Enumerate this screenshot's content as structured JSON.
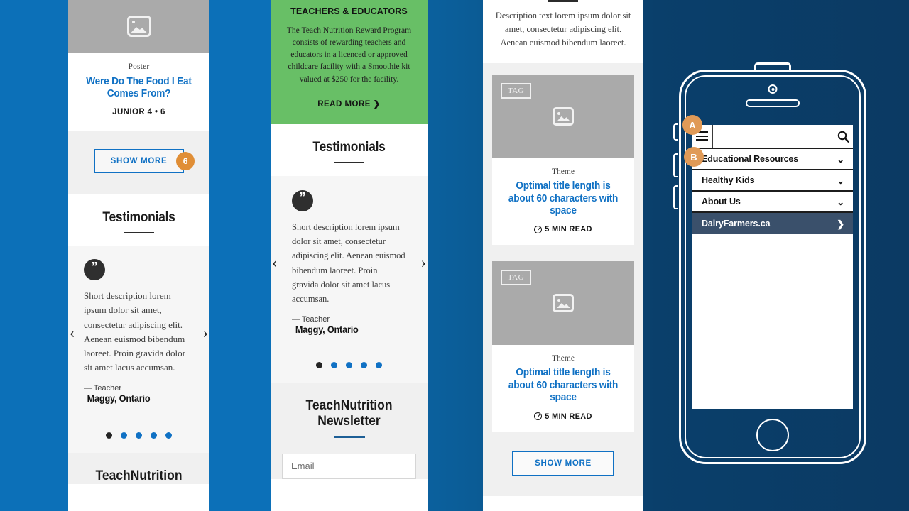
{
  "colors": {
    "bg_left": "#0c70b8",
    "bg_right": "#0b3a63",
    "accent_blue": "#1071c4",
    "accent_orange": "#e08e36",
    "green": "#68bf66",
    "dark_navy_row": "#3a506b"
  },
  "panel1": {
    "image_icon": "image-placeholder-icon",
    "kicker": "Poster",
    "title": "Were Do The Food  I Eat Comes From?",
    "grade": "JUNIOR 4 • 6",
    "show_more_label": "SHOW MORE",
    "show_more_count": "6",
    "testimonials_heading": "Testimonials",
    "quote_glyph": "”",
    "testimonial_text": "Short description lorem ipsum dolor sit amet, consectetur adipiscing elit. Aenean euismod bibendum laoreet. Proin gravida dolor sit amet lacus accumsan.",
    "testimonial_role": "— Teacher",
    "testimonial_name": "Maggy, Ontario",
    "prev_arrow": "‹",
    "next_arrow": "›",
    "dots": 5,
    "active_dot": 0,
    "footer_heading": "TeachNutrition"
  },
  "panel2": {
    "green_heading": "TEACHERS & EDUCATORS",
    "green_body": "The Teach Nutrition Reward Program consists of rewarding teachers and educators in a licenced or approved childcare facility with a Smoothie kit valued at $250 for the facility.",
    "read_more_label": "READ MORE ❯",
    "testimonials_heading": "Testimonials",
    "quote_glyph": "”",
    "testimonial_text": "Short description lorem ipsum dolor sit amet, consectetur adipiscing elit. Aenean euismod bibendum laoreet. Proin gravida dolor sit amet lacus accumsan.",
    "testimonial_role": "— Teacher",
    "testimonial_name": "Maggy, Ontario",
    "prev_arrow": "‹",
    "next_arrow": "›",
    "dots": 5,
    "active_dot": 0,
    "newsletter_heading": "TeachNutrition Newsletter",
    "email_placeholder": "Email",
    "email_value": ""
  },
  "panel3": {
    "description": "Description text lorem ipsum dolor sit amet, consectetur adipiscing elit. Aenean euismod bibendum laoreet.",
    "cards": [
      {
        "tag": "TAG",
        "theme": "Theme",
        "title": "Optimal title length is about 60 characters with space",
        "read_time": "5 MIN READ",
        "image_icon": "image-placeholder-icon"
      },
      {
        "tag": "TAG",
        "theme": "Theme",
        "title": "Optimal title length is about 60 characters with space",
        "read_time": "5 MIN READ",
        "image_icon": "image-placeholder-icon"
      }
    ],
    "show_more_label": "SHOW MORE"
  },
  "phone": {
    "callout_a": "A",
    "callout_b": "B",
    "hamburger_icon": "hamburger-menu-icon",
    "search_icon": "search-icon",
    "search_placeholder": "",
    "search_value": "",
    "menu_items": [
      {
        "label": "Educational Resources",
        "icon": "chevron-down-icon",
        "glyph": "⌄",
        "highlighted": false
      },
      {
        "label": "Healthy Kids",
        "icon": "chevron-down-icon",
        "glyph": "⌄",
        "highlighted": false
      },
      {
        "label": "About Us",
        "icon": "chevron-down-icon",
        "glyph": "⌄",
        "highlighted": false
      },
      {
        "label": "DairyFarmers.ca",
        "icon": "chevron-right-icon",
        "glyph": "❯",
        "highlighted": true
      }
    ]
  }
}
